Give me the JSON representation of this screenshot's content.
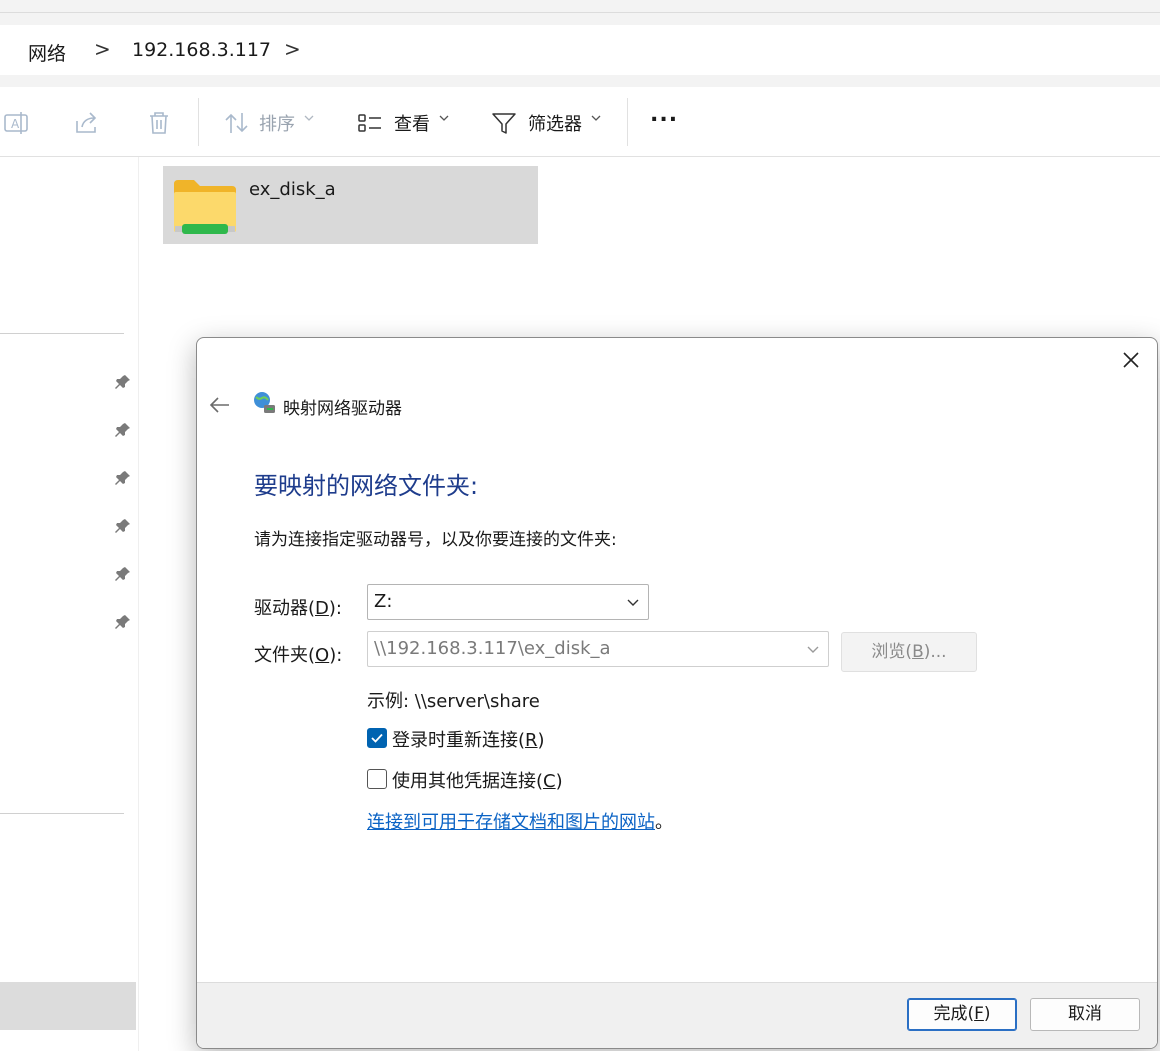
{
  "breadcrumb": {
    "items": [
      "网络",
      "192.168.3.117"
    ],
    "separator": ">"
  },
  "toolbar": {
    "sort_label": "排序",
    "view_label": "查看",
    "filter_label": "筛选器",
    "more_label": "..."
  },
  "content": {
    "folder_name": "ex_disk_a"
  },
  "dialog": {
    "title": "映射网络驱动器",
    "heading": "要映射的网络文件夹:",
    "description": "请为连接指定驱动器号，以及你要连接的文件夹:",
    "drive_label": "驱动器(",
    "drive_accel": "D",
    "drive_label_end": "):",
    "drive_value": "Z:",
    "folder_label": "文件夹(",
    "folder_accel": "O",
    "folder_label_end": "):",
    "folder_value": "\\\\192.168.3.117\\ex_disk_a",
    "browse_label": "浏览(",
    "browse_accel": "B",
    "browse_label_end": ")...",
    "example": "示例: \\\\server\\share",
    "reconnect_label": "登录时重新连接(",
    "reconnect_accel": "R",
    "reconnect_label_end": ")",
    "reconnect_checked": true,
    "other_creds_label": "使用其他凭据连接(",
    "other_creds_accel": "C",
    "other_creds_label_end": ")",
    "other_creds_checked": false,
    "link_text": "连接到可用于存储文档和图片的网站",
    "link_suffix": "。",
    "finish_label": "完成(",
    "finish_accel": "F",
    "finish_label_end": ")",
    "cancel_label": "取消"
  },
  "colors": {
    "accent": "#0063b1",
    "heading": "#1e3c8c",
    "link": "#0b63c5"
  }
}
